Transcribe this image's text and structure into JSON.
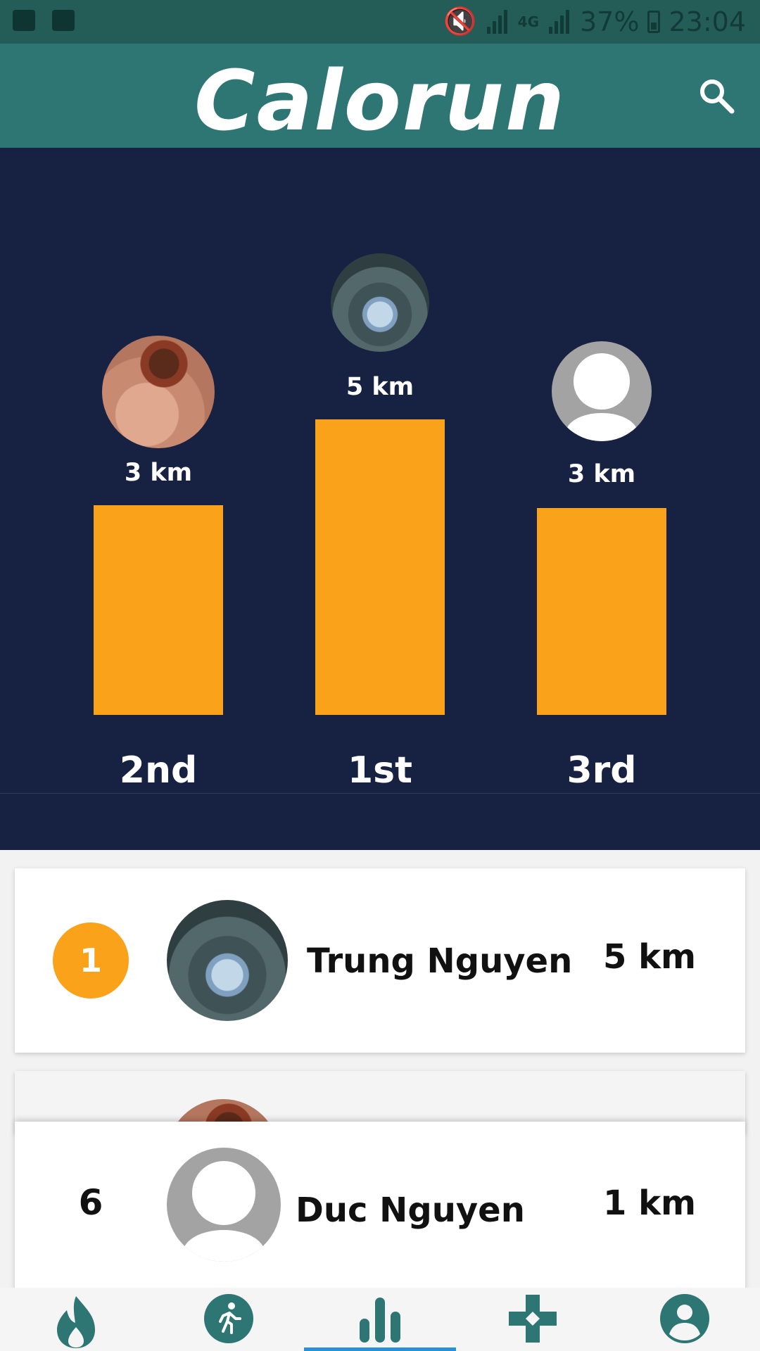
{
  "status_bar": {
    "battery": "37%",
    "time": "23:04",
    "network": "4G"
  },
  "app_bar": {
    "title": "Calorun",
    "search_icon": "search-icon"
  },
  "podium": {
    "first": {
      "distance": "5 km",
      "place": "1st"
    },
    "second": {
      "distance": "3 km",
      "place": "2nd"
    },
    "third": {
      "distance": "3 km",
      "place": "3rd"
    }
  },
  "leaderboard": [
    {
      "rank": "1",
      "name": "Trung Nguyen",
      "distance": "5 km"
    }
  ],
  "current_user": {
    "rank": "6",
    "name": "Duc Nguyen",
    "distance": "1 km"
  },
  "bottom_nav": {
    "items": [
      "flame-icon",
      "run-icon",
      "leaderboard-icon",
      "game-icon",
      "account-icon"
    ],
    "active_index": 2
  },
  "colors": {
    "app_bar": "#2d7673",
    "podium_bg": "#172242",
    "accent": "#f9a21a",
    "active_tab": "#2a8fd9"
  }
}
